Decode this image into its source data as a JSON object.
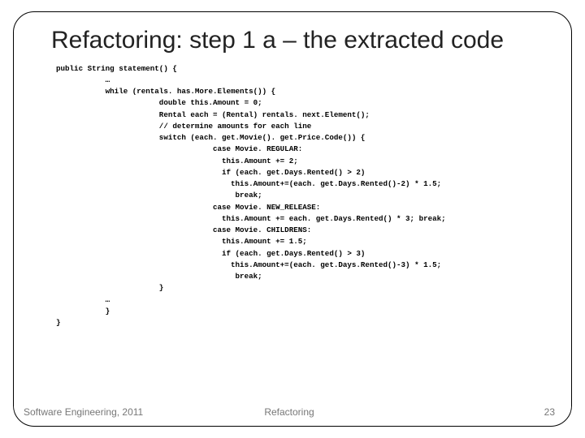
{
  "slide": {
    "title": "Refactoring: step 1 a – the extracted code",
    "footer_left": "Software Engineering, 2011",
    "footer_center": "Refactoring",
    "footer_right": "23"
  },
  "code": {
    "l01": "public String statement() {",
    "l02": "           …",
    "l03": "           while (rentals. has.More.Elements()) {",
    "l04": "                       double this.Amount = 0;",
    "l05": "                       Rental each = (Rental) rentals. next.Element();",
    "l06": "                       // determine amounts for each line",
    "l07": "                       switch (each. get.Movie(). get.Price.Code()) {",
    "l08": "                                   case Movie. REGULAR:",
    "l09": "                                     this.Amount += 2;",
    "l10": "                                     if (each. get.Days.Rented() > 2)",
    "l11": "                                       this.Amount+=(each. get.Days.Rented()-2) * 1.5;",
    "l12": "                                        break;",
    "l13": "                                   case Movie. NEW_RELEASE:",
    "l14": "                                     this.Amount += each. get.Days.Rented() * 3; break;",
    "l15": "                                   case Movie. CHILDRENS:",
    "l16": "                                     this.Amount += 1.5;",
    "l17": "                                     if (each. get.Days.Rented() > 3)",
    "l18": "                                       this.Amount+=(each. get.Days.Rented()-3) * 1.5;",
    "l19": "                                        break;",
    "l20": "                       }",
    "l21": "           …",
    "l22": "           }",
    "l23": "}"
  }
}
